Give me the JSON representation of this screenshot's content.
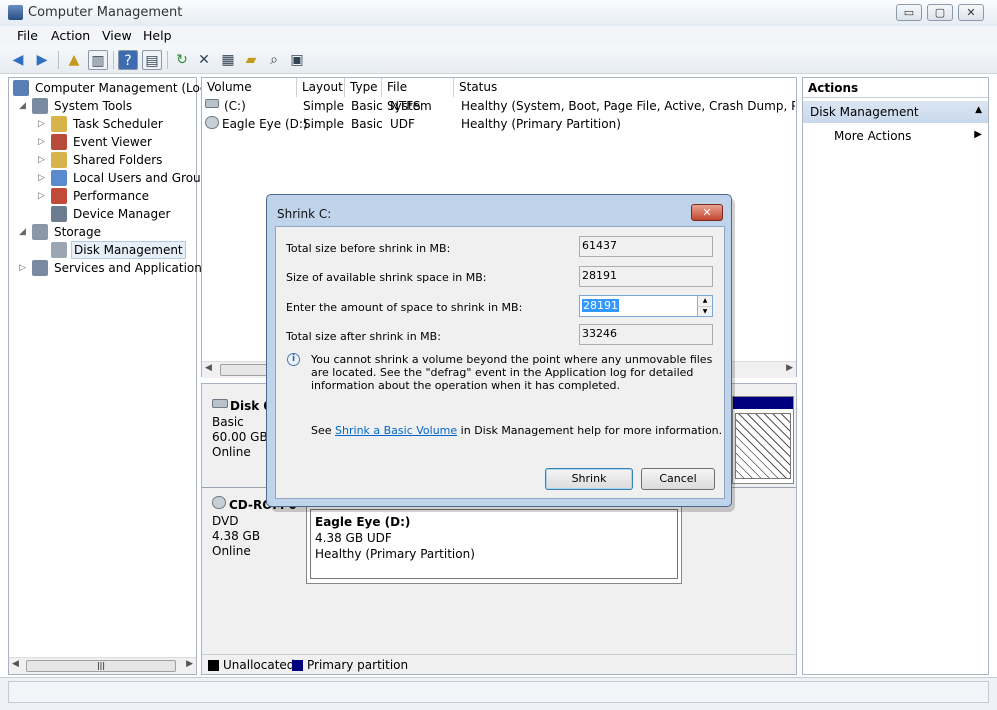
{
  "window": {
    "title": "Computer Management",
    "min_glyph": "▭",
    "max_glyph": "▢",
    "close_glyph": "✕"
  },
  "menu": [
    "File",
    "Action",
    "View",
    "Help"
  ],
  "tree": [
    {
      "label": "Computer Management (Local",
      "indent": 0,
      "arrow": "",
      "icon": "computer-icon"
    },
    {
      "label": "System Tools",
      "indent": 1,
      "arrow": "◢",
      "icon": "tools-icon"
    },
    {
      "label": "Task Scheduler",
      "indent": 2,
      "arrow": "▷",
      "icon": "clock-icon"
    },
    {
      "label": "Event Viewer",
      "indent": 2,
      "arrow": "▷",
      "icon": "event-icon"
    },
    {
      "label": "Shared Folders",
      "indent": 2,
      "arrow": "▷",
      "icon": "folder-icon"
    },
    {
      "label": "Local Users and Groups",
      "indent": 2,
      "arrow": "▷",
      "icon": "users-icon"
    },
    {
      "label": "Performance",
      "indent": 2,
      "arrow": "▷",
      "icon": "performance-icon"
    },
    {
      "label": "Device Manager",
      "indent": 2,
      "arrow": "",
      "icon": "device-icon"
    },
    {
      "label": "Storage",
      "indent": 1,
      "arrow": "◢",
      "icon": "storage-icon"
    },
    {
      "label": "Disk Management",
      "indent": 2,
      "arrow": "",
      "icon": "disk-icon",
      "selected": true
    },
    {
      "label": "Services and Applications",
      "indent": 1,
      "arrow": "▷",
      "icon": "services-icon"
    }
  ],
  "volumes": {
    "columns": [
      "Volume",
      "Layout",
      "Type",
      "File System",
      "Status"
    ],
    "rows": [
      [
        "(C:)",
        "Simple",
        "Basic",
        "NTFS",
        "Healthy (System, Boot, Page File, Active, Crash Dump, Primary P"
      ],
      [
        "Eagle Eye (D:)",
        "Simple",
        "Basic",
        "UDF",
        "Healthy (Primary Partition)"
      ]
    ]
  },
  "actions": {
    "header": "Actions",
    "section": "Disk Management",
    "more": "More Actions"
  },
  "disks": {
    "disk0": {
      "name": "Disk 0",
      "type": "Basic",
      "size": "60.00 GB",
      "state": "Online"
    },
    "cdrom": {
      "name": "CD-ROM 0",
      "type": "DVD",
      "size": "4.38 GB",
      "state": "Online"
    },
    "partition_d": {
      "name": "Eagle Eye  (D:)",
      "size": "4.38 GB UDF",
      "status": "Healthy (Primary Partition)"
    }
  },
  "legend": {
    "unallocated": "Unallocated",
    "primary": "Primary partition"
  },
  "dialog": {
    "title": "Shrink C:",
    "total_before_label": "Total size before shrink in MB:",
    "total_before": "61437",
    "available_label": "Size of available shrink space in MB:",
    "available": "28191",
    "enter_label": "Enter the amount of space to shrink in MB:",
    "enter_value": "28191",
    "after_label": "Total size after shrink in MB:",
    "after": "33246",
    "info": "You cannot shrink a volume beyond the point where any unmovable files are located. See the \"defrag\" event in the Application log for detailed information about the operation when it has completed.",
    "see_prefix": "See",
    "see_link": "Shrink a Basic Volume",
    "see_suffix": "in Disk Management help for more information.",
    "shrink_button": "Shrink",
    "cancel_button": "Cancel"
  },
  "colors": {
    "primary_blue": "#00007f",
    "link": "#0066cc",
    "selected": "#3399ff"
  }
}
